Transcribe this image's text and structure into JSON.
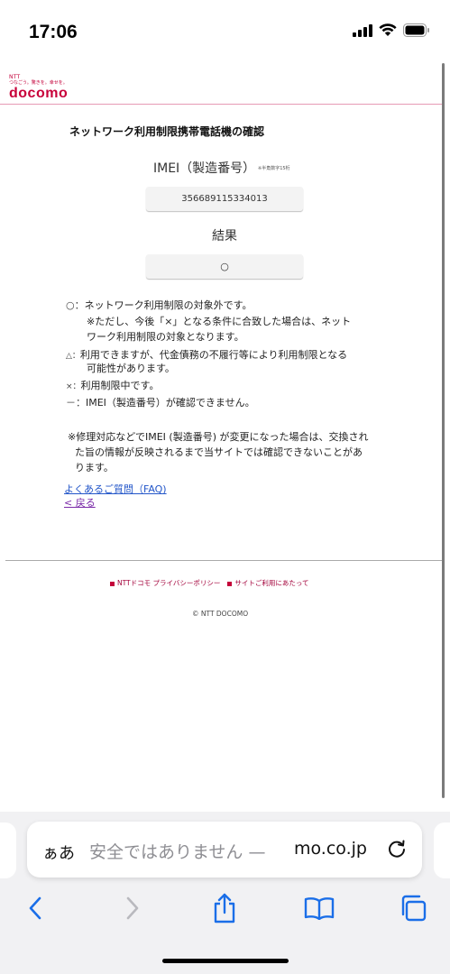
{
  "status": {
    "time": "17:06"
  },
  "header": {
    "logo_top": "NTT",
    "logo_tagline": "つなごう。驚きを。幸せを。",
    "logo_main": "docomo"
  },
  "page": {
    "title": "ネットワーク利用制限携帯電話機の確認",
    "imei_label": "IMEI（製造番号）",
    "imei_note": "※半角数字15桁",
    "imei_value": "356689115334013",
    "result_label": "結果",
    "result_value": "○"
  },
  "legend": [
    {
      "symbol": "○：",
      "text": "ネットワーク利用制限の対象外です。"
    },
    {
      "symbol": "",
      "text": "※ただし、今後「×」となる条件に合致した場合は、ネット"
    },
    {
      "symbol": "",
      "text": "ワーク利用制限の対象となります。"
    },
    {
      "symbol": "△：",
      "text": "利用できますが、代金債務の不履行等により利用制限となる"
    },
    {
      "symbol": "",
      "text": "可能性があります。"
    },
    {
      "symbol": "×：",
      "text": "利用制限中です。"
    },
    {
      "symbol": "－：",
      "text": "IMEI（製造番号）が確認できません。"
    }
  ],
  "footnote": {
    "line1": "※修理対応などでIMEI (製造番号) が変更になった場合は、交換され",
    "line2": "た旨の情報が反映されるまで当サイトでは確認できないことがあ",
    "line3": "ります。"
  },
  "links": {
    "faq": "よくあるご質問（FAQ)",
    "back": "< 戻る"
  },
  "footer": {
    "privacy": "NTTドコモ プライバシーポリシー",
    "terms": "サイトご利用にあたって",
    "copyright": "© NTT DOCOMO"
  },
  "browser": {
    "aa": "ぁあ",
    "url_gray": "安全ではありません —",
    "url_domain": "mo.co.jp"
  },
  "colors": {
    "brand": "#c8003a",
    "link": "#2356c9",
    "visited": "#7a2aa8"
  }
}
